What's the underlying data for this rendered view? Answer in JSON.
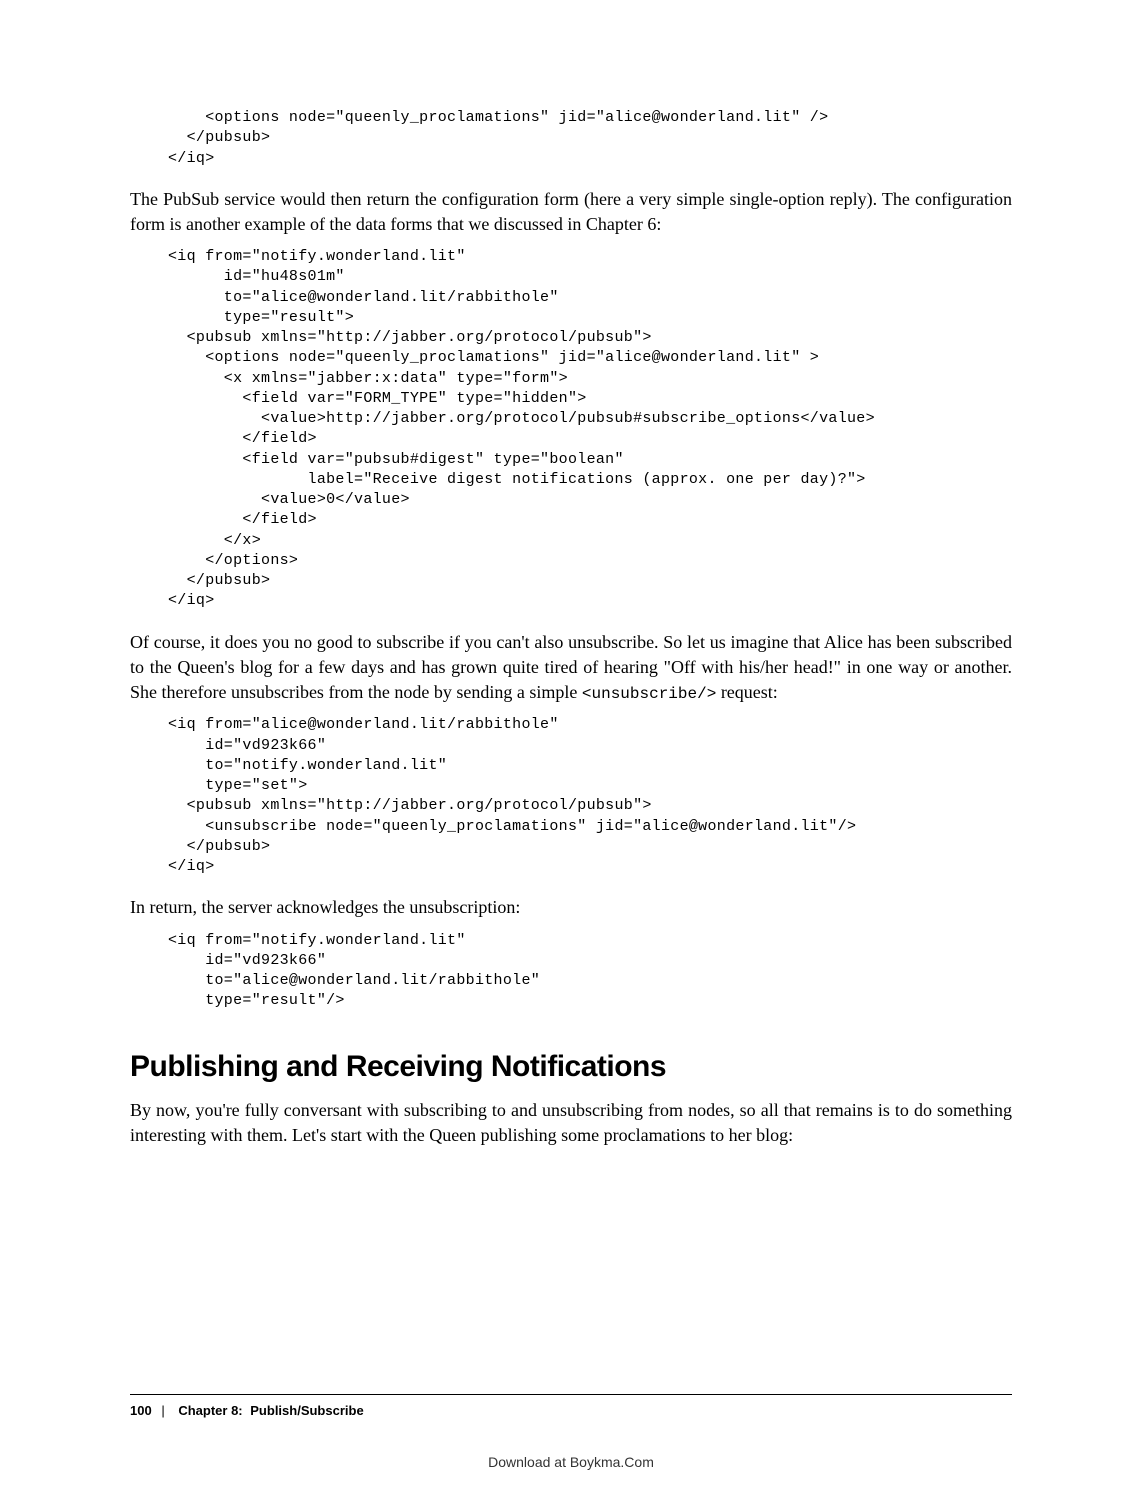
{
  "code1": "    <options node=\"queenly_proclamations\" jid=\"alice@wonderland.lit\" />\n  </pubsub>\n</iq>",
  "para1": "The PubSub service would then return the configuration form (here a very simple single-option reply). The configuration form is another example of the data forms that we discussed in Chapter 6:",
  "code2": "<iq from=\"notify.wonderland.lit\"\n      id=\"hu48s01m\"\n      to=\"alice@wonderland.lit/rabbithole\"\n      type=\"result\">\n  <pubsub xmlns=\"http://jabber.org/protocol/pubsub\">\n    <options node=\"queenly_proclamations\" jid=\"alice@wonderland.lit\" >\n      <x xmlns=\"jabber:x:data\" type=\"form\">\n        <field var=\"FORM_TYPE\" type=\"hidden\">\n          <value>http://jabber.org/protocol/pubsub#subscribe_options</value>\n        </field>\n        <field var=\"pubsub#digest\" type=\"boolean\"\n               label=\"Receive digest notifications (approx. one per day)?\">\n          <value>0</value>\n        </field>\n      </x>\n    </options>\n  </pubsub>\n</iq>",
  "para2_a": "Of course, it does you no good to subscribe if you can't also unsubscribe. So let us imagine that Alice has been subscribed to the Queen's blog for a few days and has grown quite tired of hearing \"Off with his/her head!\" in one way or another. She therefore unsubscribes from the node by sending a simple ",
  "para2_code": "<unsubscribe/>",
  "para2_b": " request:",
  "code3": "<iq from=\"alice@wonderland.lit/rabbithole\"\n    id=\"vd923k66\"\n    to=\"notify.wonderland.lit\"\n    type=\"set\">\n  <pubsub xmlns=\"http://jabber.org/protocol/pubsub\">\n    <unsubscribe node=\"queenly_proclamations\" jid=\"alice@wonderland.lit\"/>\n  </pubsub>\n</iq>",
  "para3": "In return, the server acknowledges the unsubscription:",
  "code4": "<iq from=\"notify.wonderland.lit\"\n    id=\"vd923k66\"\n    to=\"alice@wonderland.lit/rabbithole\"\n    type=\"result\"/>",
  "heading": "Publishing and Receiving Notifications",
  "para4": "By now, you're fully conversant with subscribing to and unsubscribing from nodes, so all that remains is to do something interesting with them. Let's start with the Queen publishing some proclamations to her blog:",
  "footer": {
    "page": "100",
    "chapter": "Chapter 8:",
    "title": "Publish/Subscribe"
  },
  "download": "Download at Boykma.Com"
}
